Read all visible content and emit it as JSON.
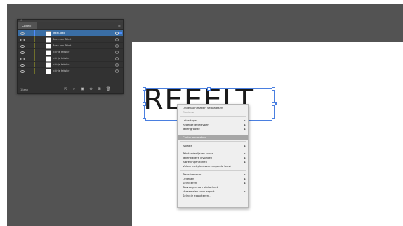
{
  "layers_panel": {
    "tab_label": "Lagen",
    "close_glyph": "×",
    "menu_glyph": "≡",
    "rows": [
      {
        "name": "Tekst.laag"
      },
      {
        "name": "Boek.van Tekst"
      },
      {
        "name": "Boek.van Tekst"
      },
      {
        "name": "<Vrije tekst>"
      },
      {
        "name": "<Vrije tekst>"
      },
      {
        "name": "<Vrije tekst>"
      },
      {
        "name": "<Vrije tekst>"
      }
    ],
    "footer_count": "1 laag"
  },
  "canvas": {
    "text": "REEELT"
  },
  "context_menu": {
    "items": [
      {
        "label": "Ongedaan maken Verplaatsen",
        "disabled": false
      },
      {
        "label": "Opnieuw",
        "disabled": true
      },
      {
        "label": "Lettertype",
        "submenu": true
      },
      {
        "label": "Recente lettertypen",
        "submenu": true
      },
      {
        "label": "Tekengrootte",
        "submenu": true
      },
      {
        "label": "Contouren maken",
        "highlighted": true
      },
      {
        "label": "Isolatie",
        "submenu": true
      },
      {
        "label": "Tekstkaderlijsten tonen",
        "submenu": true
      },
      {
        "label": "Tekenkaders invoegen",
        "submenu": true
      },
      {
        "label": "Afbrekingen tonen",
        "submenu": true
      },
      {
        "label": "Vullen met plaatsvervangende tekst",
        "submenu": false
      },
      {
        "label": "Transformeren",
        "submenu": true
      },
      {
        "label": "Ordenen",
        "submenu": true
      },
      {
        "label": "Selecteren",
        "submenu": true
      },
      {
        "label": "Toevoegen aan bibliotheek",
        "submenu": false
      },
      {
        "label": "Verzamelen voor export",
        "submenu": true
      },
      {
        "label": "Selectie exporteren...",
        "submenu": false
      }
    ]
  }
}
